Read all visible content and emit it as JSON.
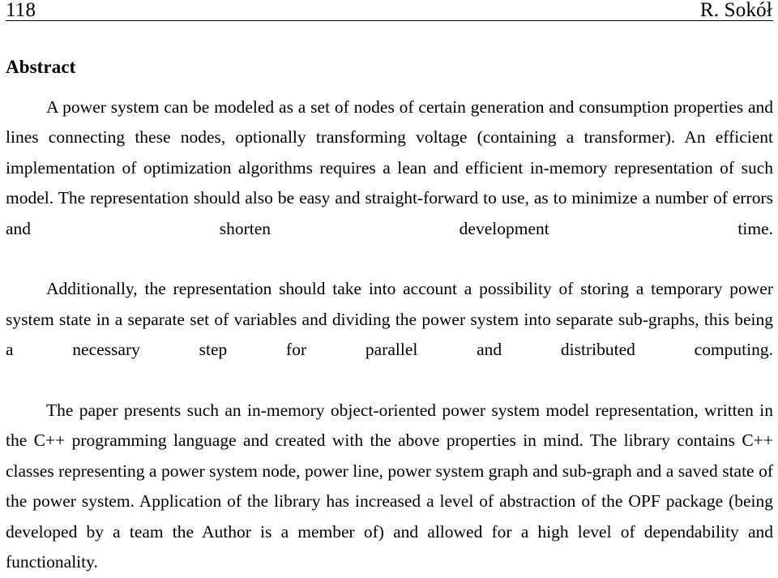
{
  "document": {
    "type": "academic-paper-page",
    "background_color": "#ffffff",
    "text_color": "#000000"
  },
  "header": {
    "page_number": "118",
    "author_running_head": "R. Sokół",
    "rule_color": "#000000"
  },
  "abstract": {
    "heading": "Abstract",
    "paragraphs": [
      "A power system can be modeled as a set of nodes of certain generation and consumption properties and lines connecting these nodes, optionally transforming voltage (containing a transformer). An efficient implementation of optimization algorithms requires a lean and efficient in-memory representation of such model. The representation should also be easy and straight-forward to use, as to minimize a number of errors and shorten development time.",
      "Additionally, the representation should take into account a possibility of storing a temporary power system state in a separate set of variables and dividing the power system into separate sub-graphs, this being a necessary step for parallel and distributed computing.",
      "The paper presents such an in-memory object-oriented power system model representation, written in the C++ programming language and created with the above properties in mind. The library contains C++ classes representing a power system node, power line, power system graph and sub-graph and a saved state of the power system. Application of the library has increased a level of abstraction of the OPF package (being developed by a team the Author is a member of) and allowed for a high level of dependability and functionality."
    ]
  }
}
